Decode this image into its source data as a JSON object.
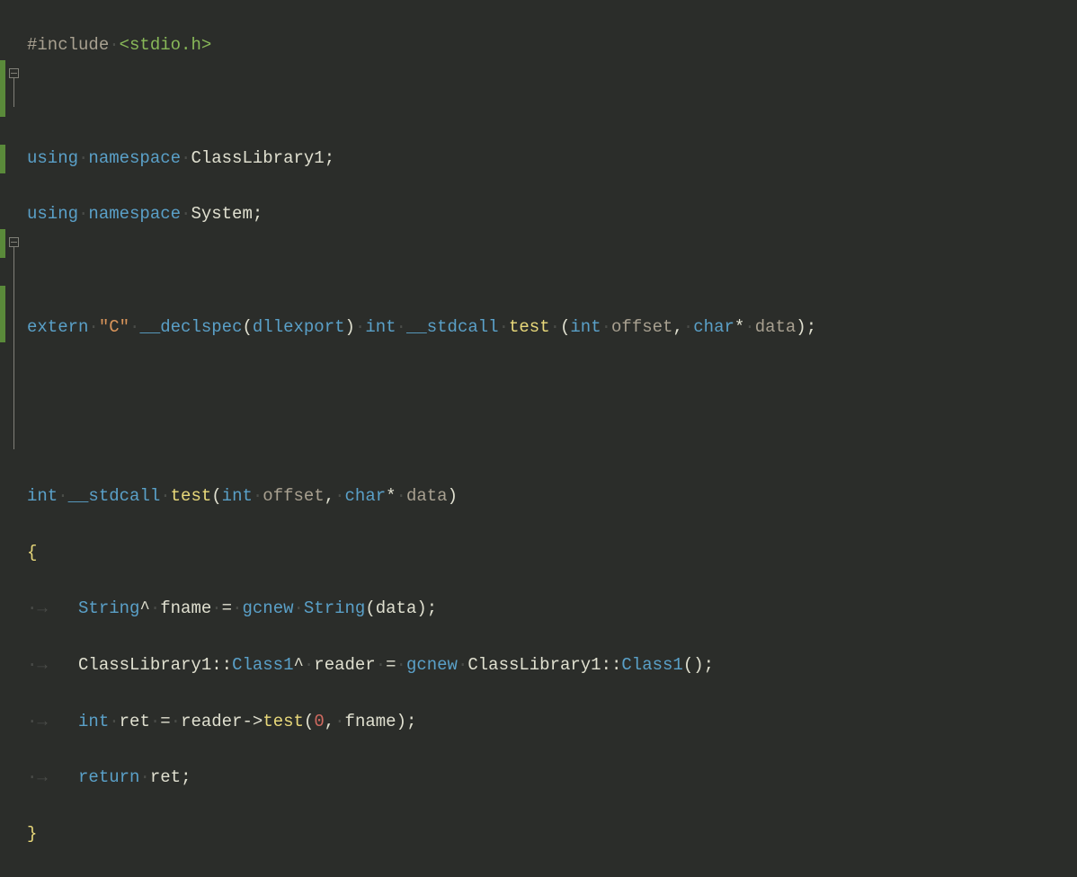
{
  "code": {
    "l1": {
      "pp": "#include",
      "ws1": "·",
      "inc": "<stdio.h>"
    },
    "l3": {
      "kw1": "using",
      "ws1": "·",
      "kw2": "namespace",
      "ws2": "·",
      "id": "ClassLibrary1",
      "semi": ";"
    },
    "l4": {
      "kw1": "using",
      "ws1": "·",
      "kw2": "namespace",
      "ws2": "·",
      "id": "System",
      "semi": ";"
    },
    "l6": {
      "kw1": "extern",
      "ws1": "·",
      "str": "\"C\"",
      "ws2": "·",
      "kw2": "__declspec",
      "lp": "(",
      "kw3": "dllexport",
      "rp": ")",
      "ws3": "·",
      "ty": "int",
      "ws4": "·",
      "cc": "__stdcall",
      "ws5": "·",
      "fn": "test",
      "ws6": "·",
      "lp2": "(",
      "ty2": "int",
      "ws7": "·",
      "p1": "offset",
      "c1": ",",
      "ws8": "·",
      "ty3": "char",
      "star": "*",
      "ws9": "·",
      "p2": "data",
      "rp2": ")",
      "semi": ";"
    },
    "l9": {
      "ty": "int",
      "ws1": "·",
      "cc": "__stdcall",
      "ws2": "·",
      "fn": "test",
      "lp": "(",
      "ty2": "int",
      "ws3": "·",
      "p1": "offset",
      "c1": ",",
      "ws4": "·",
      "ty3": "char",
      "star": "*",
      "ws5": "·",
      "p2": "data",
      "rp": ")"
    },
    "l10": {
      "br": "{"
    },
    "l11": {
      "ind": "·→   ",
      "ty": "String",
      "hat": "^",
      "ws1": "·",
      "id": "fname",
      "ws2": "·",
      "eq": "=",
      "ws3": "·",
      "kw": "gcnew",
      "ws4": "·",
      "ty2": "String",
      "lp": "(",
      "arg": "data",
      "rp": ")",
      "semi": ";"
    },
    "l12": {
      "ind": "·→   ",
      "ns1": "ClassLibrary1",
      "sc1": "::",
      "cls": "Class1",
      "hat": "^",
      "ws1": "·",
      "id": "reader",
      "ws2": "·",
      "eq": "=",
      "ws3": "·",
      "kw": "gcnew",
      "ws4": "·",
      "ns2": "ClassLibrary1",
      "sc2": "::",
      "cls2": "Class1",
      "lp": "(",
      "rp": ")",
      "semi": ";"
    },
    "l13": {
      "ind": "·→   ",
      "ty": "int",
      "ws1": "·",
      "id": "ret",
      "ws2": "·",
      "eq": "=",
      "ws3": "·",
      "obj": "reader",
      "arr": "->",
      "fn": "test",
      "lp": "(",
      "num": "0",
      "c1": ",",
      "ws4": "·",
      "arg": "fname",
      "rp": ")",
      "semi": ";"
    },
    "l14": {
      "ind": "·→   ",
      "kw": "return",
      "ws1": "·",
      "id": "ret",
      "semi": ";"
    },
    "l15": {
      "br": "}"
    }
  }
}
